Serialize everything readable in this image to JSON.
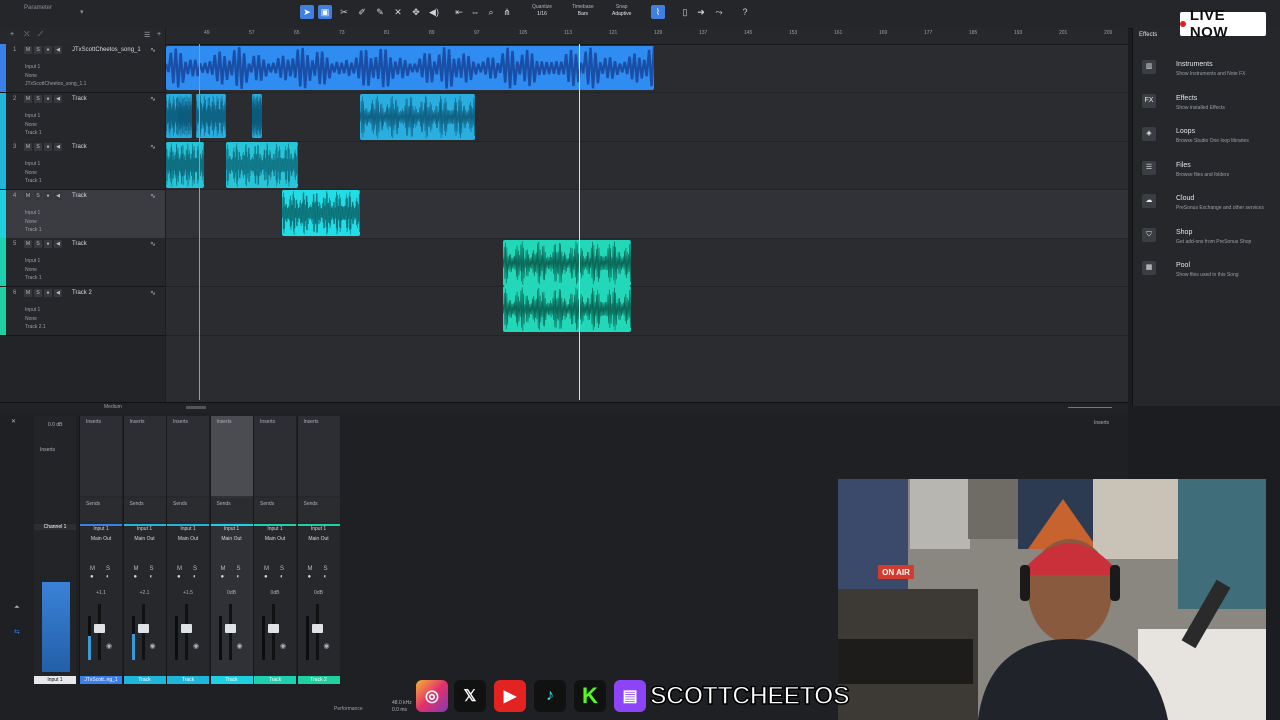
{
  "toolbar": {
    "parameter_label": "Parameter",
    "quantize": {
      "label": "Quantize",
      "value": "1/16"
    },
    "timebase": {
      "label": "Timebase",
      "value": "Bars"
    },
    "snap": {
      "label": "Snap",
      "value": "Adaptive"
    },
    "help": "?"
  },
  "ruler": {
    "bars": [
      "49",
      "57",
      "65",
      "73",
      "81",
      "89",
      "97",
      "105",
      "113",
      "121",
      "129",
      "137",
      "145",
      "153",
      "161",
      "169",
      "177",
      "185",
      "193",
      "201",
      "209"
    ]
  },
  "tracks": [
    {
      "num": "1",
      "name": "JTxScottCheetos_song_1",
      "input": "Input 1",
      "out": "None",
      "sub": "JTxScottCheetos_song_1.1",
      "color": "#3b7fe8"
    },
    {
      "num": "2",
      "name": "Track",
      "input": "Input 1",
      "out": "None",
      "sub": "Track 1",
      "color": "#1fb6d9"
    },
    {
      "num": "3",
      "name": "Track",
      "input": "Input 1",
      "out": "None",
      "sub": "Track 1",
      "color": "#1fb6d9"
    },
    {
      "num": "4",
      "name": "Track",
      "input": "Input 1",
      "out": "None",
      "sub": "Track 1",
      "color": "#1fd0e0"
    },
    {
      "num": "5",
      "name": "Track",
      "input": "Input 1",
      "out": "None",
      "sub": "Track 1",
      "color": "#1fd0b0"
    },
    {
      "num": "6",
      "name": "Track 2",
      "input": "Input 1",
      "out": "None",
      "sub": "Track 2.1",
      "color": "#1fd0a0"
    }
  ],
  "browser": {
    "tab_effects": "Effects",
    "items": [
      {
        "icon": "piano-icon",
        "glyph": "▥",
        "title": "Instruments",
        "desc": "Show Instruments and Note FX"
      },
      {
        "icon": "fx-icon",
        "glyph": "FX",
        "title": "Effects",
        "desc": "Show installed Effects"
      },
      {
        "icon": "loops-icon",
        "glyph": "◈",
        "title": "Loops",
        "desc": "Browse Studio One loop libraries"
      },
      {
        "icon": "files-icon",
        "glyph": "☰",
        "title": "Files",
        "desc": "Browse files and folders"
      },
      {
        "icon": "cloud-icon",
        "glyph": "☁",
        "title": "Cloud",
        "desc": "PreSonus Exchange and other services"
      },
      {
        "icon": "shop-icon",
        "glyph": "⛉",
        "title": "Shop",
        "desc": "Get add-ons from PreSonus Shop"
      },
      {
        "icon": "pool-icon",
        "glyph": "▦",
        "title": "Pool",
        "desc": "Show files used in this Song"
      }
    ]
  },
  "live_badge": "LIVE NOW",
  "mixer": {
    "zoom_label": "Medium",
    "channel1": {
      "name": "Channel 1",
      "db": "0.0 dB",
      "foot": "Input 1"
    },
    "strips": [
      {
        "inserts": "Inserts",
        "sends": "Sends",
        "input": "Input 1",
        "out": "Main Out",
        "vol": "+1.1",
        "foot": "JTxScott..ng_1",
        "color": "#3b7fe8",
        "level": 0.55
      },
      {
        "inserts": "Inserts",
        "sends": "Sends",
        "input": "Input 1",
        "out": "Main Out",
        "vol": "+2.1",
        "foot": "Track",
        "color": "#1fb6d9",
        "level": 0.6
      },
      {
        "inserts": "Inserts",
        "sends": "Sends",
        "input": "Input 1",
        "out": "Main Out",
        "vol": "+1.5",
        "foot": "Track",
        "color": "#1fb6d9",
        "level": 0.0
      },
      {
        "inserts": "Inserts",
        "sends": "Sends",
        "input": "Input 1",
        "out": "Main Out",
        "vol": "0dB",
        "foot": "Track",
        "color": "#1fd0e0",
        "level": 0.0
      },
      {
        "inserts": "Inserts",
        "sends": "Sends",
        "input": "Input 1",
        "out": "Main Out",
        "vol": "0dB",
        "foot": "Track",
        "color": "#1fd0b0",
        "level": 0.0
      },
      {
        "inserts": "Inserts",
        "sends": "Sends",
        "input": "Input 1",
        "out": "Main Out",
        "vol": "0dB",
        "foot": "Track 2",
        "color": "#1fd0a0",
        "level": 0.0
      }
    ],
    "right_inserts": "Inserts"
  },
  "social": {
    "handle": "SCOTTCHEETOS",
    "icons": [
      "instagram-icon",
      "x-icon",
      "youtube-icon",
      "tiktok-icon",
      "kick-icon",
      "twitch-icon"
    ]
  },
  "webcam": {
    "sign": "ON AIR"
  },
  "status": {
    "performance": "Performance",
    "rate": "48.0 kHz",
    "latency": "0.0 ms"
  }
}
